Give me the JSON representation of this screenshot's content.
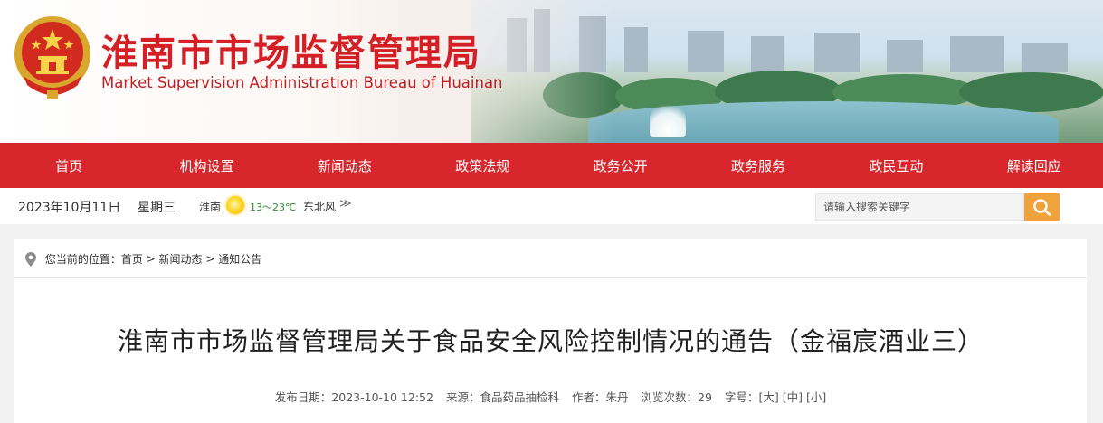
{
  "header": {
    "title": "淮南市市场监督管理局",
    "subtitle": "Market Supervision Administration Bureau of Huainan",
    "brand_red": "#d51f26"
  },
  "nav": {
    "items": [
      {
        "label": "首页"
      },
      {
        "label": "机构设置"
      },
      {
        "label": "新闻动态"
      },
      {
        "label": "政策法规"
      },
      {
        "label": "政务公开"
      },
      {
        "label": "政务服务"
      },
      {
        "label": "政民互动"
      },
      {
        "label": "解读回应"
      }
    ],
    "background": "#d7272c"
  },
  "infobar": {
    "date": "2023年10月11日",
    "weekday": "星期三",
    "city": "淮南",
    "weather_icon": "sun-icon",
    "temperature": "13～23℃",
    "wind": "东北风",
    "more_glyph": "≫",
    "search_placeholder": "请输入搜索关键字",
    "search_button_color": "#f0a23b"
  },
  "breadcrumb": {
    "prefix": "您当前的位置：",
    "items": [
      "首页",
      "新闻动态",
      "通知公告"
    ],
    "separator": " > "
  },
  "article": {
    "title": "淮南市市场监督管理局关于食品安全风险控制情况的通告（金福宸酒业三）",
    "published_label": "发布日期：",
    "published": "2023-10-10 12:52",
    "source_label": "来源：",
    "source": "食品药品抽检科",
    "author_label": "作者：",
    "author": "朱丹",
    "views_label": "浏览次数：",
    "views": "29",
    "font_size_label": "字号：",
    "font_sizes": [
      "[大]",
      "[中]",
      "[小]"
    ]
  }
}
